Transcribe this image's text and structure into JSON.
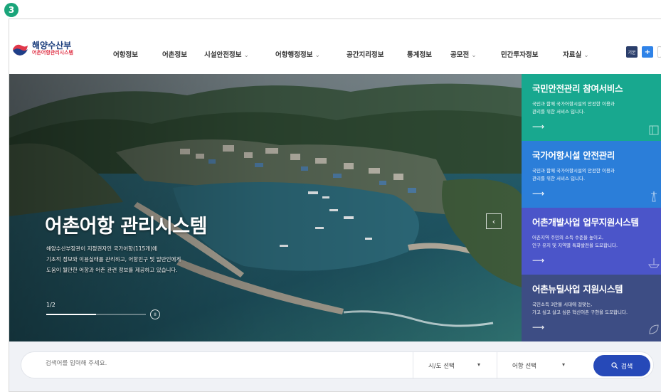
{
  "badge": "3",
  "header": {
    "logo_main": "해양수산부",
    "logo_sub": "어촌어항관리시스템",
    "nav": [
      {
        "label": "어항정보",
        "dropdown": false
      },
      {
        "label": "어촌정보",
        "dropdown": false
      },
      {
        "label": "시설안전정보",
        "dropdown": true
      },
      {
        "label": "어항행정정보",
        "dropdown": true
      },
      {
        "label": "공간지리정보",
        "dropdown": false
      },
      {
        "label": "통계정보",
        "dropdown": false
      },
      {
        "label": "공모전",
        "dropdown": true
      },
      {
        "label": "민간투자정보",
        "dropdown": false
      },
      {
        "label": "자료실",
        "dropdown": true
      }
    ],
    "btn_basic": "기본",
    "btn_plus": "+"
  },
  "hero": {
    "title": "어촌어항 관리시스템",
    "desc_lines": [
      "해양수산부장관이 지정권자인 국가어항(115개)에",
      "기초적 정보와 이용실태를 관리하고, 어항민구 및 일반인에게",
      "도움이 될만한 어항과 어촌 관련 정보를 제공하고 있습니다."
    ],
    "page": "1/2",
    "progress": 0.5,
    "pause": "II",
    "prev": "‹"
  },
  "panels": [
    {
      "title": "국민안전관리 참여서비스",
      "desc": [
        "국민과 함께 국가어항시설의 안전한 이용과",
        "관리를 위한 서비스 입니다."
      ],
      "arrow": "⟶",
      "color": "#18a88f",
      "icon": "building-icon"
    },
    {
      "title": "국가어항시설 안전관리",
      "desc": [
        "국민과 함께 국가어항시설의 안전한 이용과",
        "관리를 위한 서비스 입니다."
      ],
      "arrow": "⟶",
      "color": "#2b7ed9",
      "icon": "lighthouse-icon"
    },
    {
      "title": "어촌개발사업 업무지원시스템",
      "desc": [
        "어촌지역 주민의 소득 수준을 높이고,",
        "인구 유지 및 지역별 특화발전을 도모합니다."
      ],
      "arrow": "⟶",
      "color": "#4b55c9",
      "icon": "boat-icon"
    },
    {
      "title": "어촌뉴딜사업 지원시스템",
      "desc": [
        "국민소득 3만불 시대에 걸맞는,",
        "가고 싶고 살고 싶은 혁신어촌 구현을 도모합니다."
      ],
      "arrow": "⟶",
      "color": "#3d4d84",
      "icon": "leaf-icon"
    }
  ],
  "search": {
    "placeholder": "검색어를 입력해 주세요.",
    "sido": "시/도 선택",
    "port": "어항 선택",
    "button": "검색",
    "caret": "▾"
  }
}
